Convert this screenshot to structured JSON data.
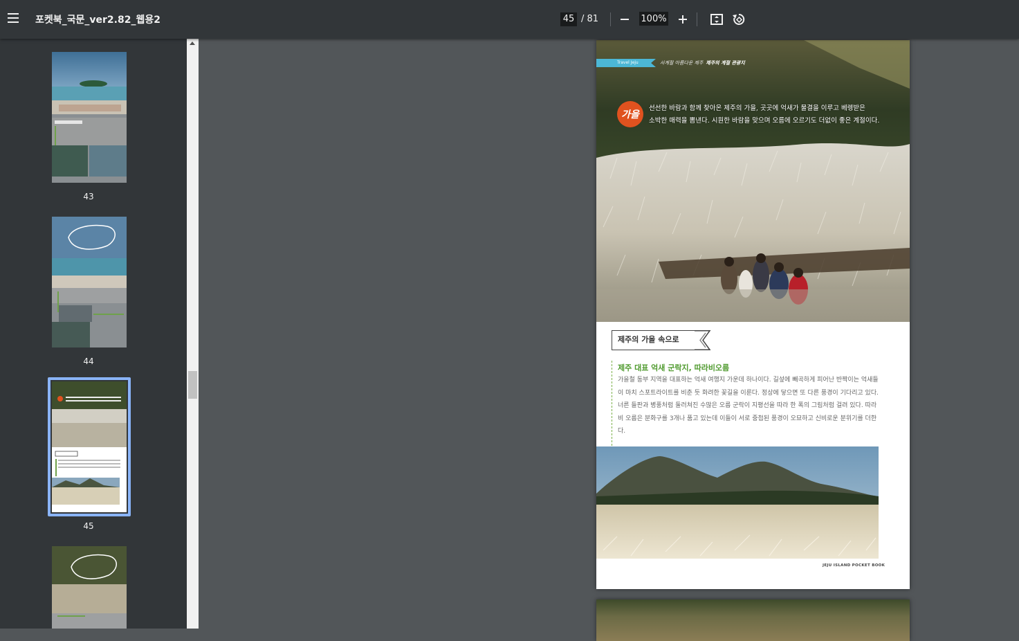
{
  "toolbar": {
    "title": "포켓북_국문_ver2.82_웹용2",
    "current_page": "45",
    "page_total": "/ 81",
    "zoom": "100%",
    "icons": [
      "menu-icon",
      "zoom-out-icon",
      "zoom-in-icon",
      "fit-page-icon",
      "rotate-icon"
    ]
  },
  "sidebar": {
    "thumbnails": [
      {
        "label": "43"
      },
      {
        "label": "44"
      },
      {
        "label": "45",
        "selected": true
      },
      {
        "label": ""
      }
    ]
  },
  "page": {
    "header_tag": "Travel Jeju",
    "header_sub": "사계절 아름다운 제주",
    "header_sub_bold": "제주의 계절 관광지",
    "season_badge": "가을",
    "intro_line1": "선선한 바람과 함께 찾아온 제주의 가을, 곳곳에 억새가 물결을 이루고 베렝받은",
    "intro_line2": "소박한 매력을 뽐낸다. 시원한 바람을 맞으며 오름에 오르기도 더없이 좋은 계절이다.",
    "section_title": "제주의 가을 속으로",
    "body_title": "제주 대표 억새 군락지, 따라비오름",
    "body_text": "가을철 동부 지역을 대표하는 억새 여행지 가운데 하나이다. 길섶에 빼곡하게 피어난 반짝이는 억새들이 마치 스포트라이트를 비춘 듯 화려한 꽃길을 이룬다. 정상에 닿으면 또 다른 풍경이 기다리고 있다. 너른 들판과 병풍처럼 둘러쳐진 수많은 오름 군락이 지평선을 따라 한 폭의 그림처럼 걸려 있다. 따라비 오름은 분화구를 3개나 품고 있는데 이들이 서로 중첩된 풍경이 오묘하고 신비로운 분위기를 더한다.",
    "footer": "JEJU ISLAND POCKET BOOK"
  },
  "colors": {
    "toolbar_bg": "#323639",
    "viewer_bg": "#525659",
    "accent_selection": "#8ab4f8",
    "tag_blue": "#4cb7d6",
    "badge_orange": "#e0521f",
    "title_green": "#4f9a2e"
  }
}
